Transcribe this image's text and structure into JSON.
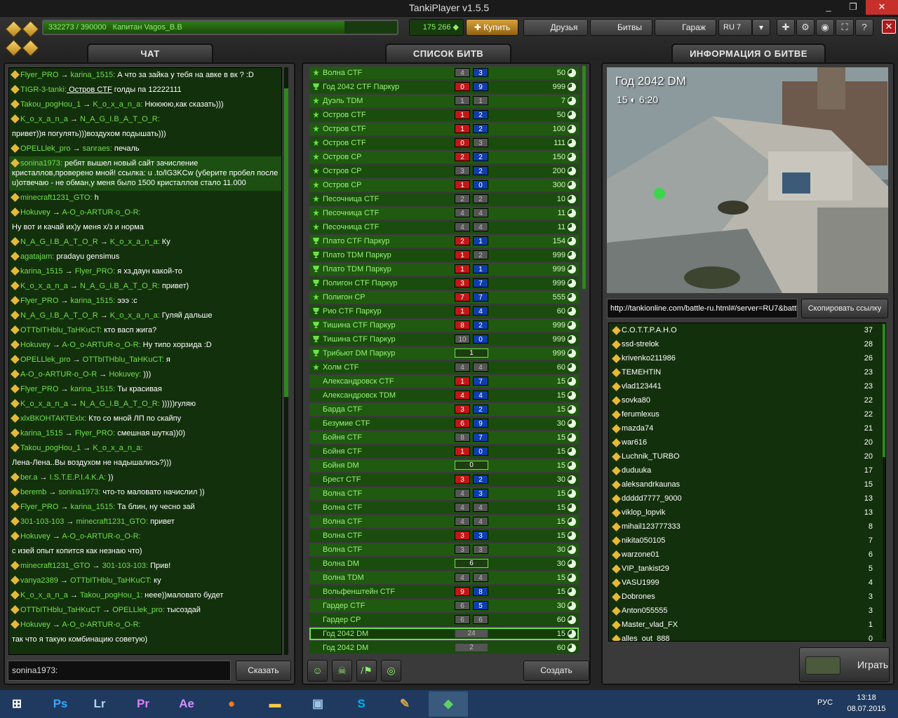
{
  "window": {
    "title": "TankiPlayer v1.5.5",
    "min": "_",
    "max": "❐",
    "close": "✕"
  },
  "top": {
    "exp": "332273 / 390000",
    "exp_fraction": 0.852,
    "player": "Капитан Vagos_B.B",
    "crystals": "175 266",
    "buy": "Купить",
    "friends": "Друзья",
    "battles": "Битвы",
    "garage": "Гараж",
    "lang": "RU 7",
    "close": "✕"
  },
  "tabs": {
    "chat": "ЧАТ",
    "battles": "СПИСОК БИТВ",
    "info": "ИНФОРМАЦИЯ О БИТВЕ"
  },
  "chat": [
    {
      "p": [
        [
          "s",
          "Flyer_PRO"
        ],
        [
          "a",
          " → "
        ],
        [
          "r",
          "karina_1515:"
        ],
        [
          "t",
          " А что за зайка у тебя на авке в вк ? :D"
        ]
      ]
    },
    {
      "p": [
        [
          "s",
          "TIGR-3-tanki:"
        ],
        [
          "u",
          " Остров CTF"
        ],
        [
          "t",
          " голды па 12222111"
        ]
      ]
    },
    {
      "p": [
        [
          "s",
          "Takou_pogHou_1"
        ],
        [
          "a",
          " → "
        ],
        [
          "r",
          "K_o_x_a_n_a:"
        ],
        [
          "t",
          " Нюююю,как сказать)))"
        ]
      ]
    },
    {
      "p": [
        [
          "s",
          "K_o_x_a_n_a"
        ],
        [
          "a",
          " → "
        ],
        [
          "r",
          "N_A_G_I.B_A_T_O_R:"
        ]
      ]
    },
    {
      "p": [
        [
          "t",
          "привет))я погулять)))воздухом подышать)))"
        ]
      ],
      "np": 1
    },
    {
      "p": [
        [
          "s",
          "OPELLlek_pro"
        ],
        [
          "a",
          " → "
        ],
        [
          "r",
          "sanraes:"
        ],
        [
          "t",
          " печаль"
        ]
      ]
    },
    {
      "p": [
        [
          "s",
          "sonina1973:"
        ],
        [
          "t",
          " ребят вышел новый сайт зачисление кристаллов,проверено мной! ссылка: u .to/lG3KCw (уберите пробел после u)отвечаю - не обман,у меня было 1500 кристаллов стало 11.000"
        ]
      ],
      "hl": 1
    },
    {
      "p": [
        [
          "s",
          "minecraft1231_GTO:"
        ],
        [
          "t",
          " h"
        ]
      ]
    },
    {
      "p": [
        [
          "s",
          "Hokuvey"
        ],
        [
          "a",
          " → "
        ],
        [
          "r",
          "A-O_o-ARTUR-o_O-R:"
        ]
      ]
    },
    {
      "p": [
        [
          "t",
          "Ну вот и качай их)у меня х/з и норма"
        ]
      ],
      "np": 1
    },
    {
      "p": [
        [
          "s",
          "N_A_G_I.B_A_T_O_R"
        ],
        [
          "a",
          " → "
        ],
        [
          "r",
          "K_o_x_a_n_a:"
        ],
        [
          "t",
          " Ку"
        ]
      ]
    },
    {
      "p": [
        [
          "s",
          "agatajam:"
        ],
        [
          "t",
          " pradayu gensimus"
        ]
      ]
    },
    {
      "p": [
        [
          "s",
          "karina_1515"
        ],
        [
          "a",
          " → "
        ],
        [
          "r",
          "Flyer_PRO:"
        ],
        [
          "t",
          " я хз,даун какой-то"
        ]
      ]
    },
    {
      "p": [
        [
          "s",
          "K_o_x_a_n_a"
        ],
        [
          "a",
          " → "
        ],
        [
          "r",
          "N_A_G_I.B_A_T_O_R:"
        ],
        [
          "t",
          " привет)"
        ]
      ]
    },
    {
      "p": [
        [
          "s",
          "Flyer_PRO"
        ],
        [
          "a",
          " → "
        ],
        [
          "r",
          "karina_1515:"
        ],
        [
          "t",
          " эээ :c"
        ]
      ]
    },
    {
      "p": [
        [
          "s",
          "N_A_G_I.B_A_T_O_R"
        ],
        [
          "a",
          " → "
        ],
        [
          "r",
          "K_o_x_a_n_a:"
        ],
        [
          "t",
          " Гуляй дальше"
        ]
      ]
    },
    {
      "p": [
        [
          "s",
          "OTTbITHblu_TaHKuCT:"
        ],
        [
          "t",
          " кто васп жига?"
        ]
      ]
    },
    {
      "p": [
        [
          "s",
          "Hokuvey"
        ],
        [
          "a",
          " → "
        ],
        [
          "r",
          "A-O_o-ARTUR-o_O-R:"
        ],
        [
          "t",
          " Ну типо хорзида :D"
        ]
      ]
    },
    {
      "p": [
        [
          "s",
          "OPELLlek_pro"
        ],
        [
          "a",
          " → "
        ],
        [
          "r",
          "OTTbITHblu_TaHKuCT:"
        ],
        [
          "t",
          " я"
        ]
      ]
    },
    {
      "p": [
        [
          "s",
          "A-O_o-ARTUR-o_O-R"
        ],
        [
          "a",
          " → "
        ],
        [
          "r",
          "Hokuvey:"
        ],
        [
          "t",
          " )))"
        ]
      ]
    },
    {
      "p": [
        [
          "s",
          "Flyer_PRO"
        ],
        [
          "a",
          " → "
        ],
        [
          "r",
          "karina_1515:"
        ],
        [
          "t",
          " Ты красивая"
        ]
      ]
    },
    {
      "p": [
        [
          "s",
          "K_o_x_a_n_a"
        ],
        [
          "a",
          " → "
        ],
        [
          "r",
          "N_A_G_I.B_A_T_O_R:"
        ],
        [
          "t",
          " )))))гуляю"
        ]
      ]
    },
    {
      "p": [
        [
          "s",
          "xlxВКОНТАКТЕxlx:"
        ],
        [
          "t",
          " Кто со мной ЛП по скайпу"
        ]
      ]
    },
    {
      "p": [
        [
          "s",
          "karina_1515"
        ],
        [
          "a",
          " → "
        ],
        [
          "r",
          "Flyer_PRO:"
        ],
        [
          "t",
          " смешная шутка))0)"
        ]
      ]
    },
    {
      "p": [
        [
          "s",
          "Takou_pogHou_1"
        ],
        [
          "a",
          " → "
        ],
        [
          "r",
          "K_o_x_a_n_a:"
        ]
      ]
    },
    {
      "p": [
        [
          "t",
          "Лена-Лена..Вы воздухом не надышались?)))"
        ]
      ],
      "np": 1
    },
    {
      "p": [
        [
          "s",
          "ber.a"
        ],
        [
          "a",
          " → "
        ],
        [
          "r",
          "I.S.T.E.P.I.4.K.A:"
        ],
        [
          "t",
          " ))"
        ]
      ]
    },
    {
      "p": [
        [
          "s",
          "beremb"
        ],
        [
          "a",
          " → "
        ],
        [
          "r",
          "sonina1973:"
        ],
        [
          "t",
          " что-то маловато начислил ))"
        ]
      ]
    },
    {
      "p": [
        [
          "s",
          "Flyer_PRO"
        ],
        [
          "a",
          " → "
        ],
        [
          "r",
          "karina_1515:"
        ],
        [
          "t",
          " Та блин, ну чесно зай"
        ]
      ]
    },
    {
      "p": [
        [
          "s",
          "301-103-103"
        ],
        [
          "a",
          " → "
        ],
        [
          "r",
          "minecraft1231_GTO:"
        ],
        [
          "t",
          " привет"
        ]
      ]
    },
    {
      "p": [
        [
          "s",
          "Hokuvey"
        ],
        [
          "a",
          " → "
        ],
        [
          "r",
          "A-O_o-ARTUR-o_O-R:"
        ]
      ]
    },
    {
      "p": [
        [
          "t",
          "с изей опыт копится как незнаю что)"
        ]
      ],
      "np": 1
    },
    {
      "p": [
        [
          "s",
          "minecraft1231_GTO"
        ],
        [
          "a",
          " → "
        ],
        [
          "r",
          "301-103-103:"
        ],
        [
          "t",
          " Прив!"
        ]
      ]
    },
    {
      "p": [
        [
          "s",
          "vanya2389"
        ],
        [
          "a",
          " → "
        ],
        [
          "r",
          "OTTbITHblu_TaHKuCT:"
        ],
        [
          "t",
          " ку"
        ]
      ]
    },
    {
      "p": [
        [
          "s",
          "K_o_x_a_n_a"
        ],
        [
          "a",
          " → "
        ],
        [
          "r",
          "Takou_pogHou_1:"
        ],
        [
          "t",
          " неее))маловато будет"
        ]
      ]
    },
    {
      "p": [
        [
          "s",
          "OTTbITHblu_TaHKuCT"
        ],
        [
          "a",
          " → "
        ],
        [
          "r",
          "OPELLlek_pro:"
        ],
        [
          "t",
          " тысоздай"
        ]
      ]
    },
    {
      "p": [
        [
          "s",
          "Hokuvey"
        ],
        [
          "a",
          " → "
        ],
        [
          "r",
          "A-O_o-ARTUR-o_O-R:"
        ]
      ]
    },
    {
      "p": [
        [
          "t",
          "так что я такую комбинацию советую)"
        ]
      ],
      "np": 1
    }
  ],
  "chat_input": "sonina1973:",
  "say": "Сказать",
  "battles": [
    {
      "n": "Волна CTF",
      "r": "4",
      "b": "3",
      "rz": 1,
      "l": "50",
      "m": "f",
      "i": "s"
    },
    {
      "n": "Год 2042 CTF Паркур",
      "r": "0",
      "b": "9",
      "l": "999",
      "m": "c",
      "i": "c"
    },
    {
      "n": "Дуэль TDM",
      "r": "1",
      "b": "1",
      "rz": 1,
      "bz": 1,
      "l": "7",
      "m": "c",
      "i": "s"
    },
    {
      "n": "Остров CTF",
      "r": "1",
      "b": "2",
      "l": "50",
      "m": "f",
      "i": "s"
    },
    {
      "n": "Остров CTF",
      "r": "1",
      "b": "2",
      "l": "100",
      "m": "f",
      "i": "s"
    },
    {
      "n": "Остров CTF",
      "r": "0",
      "b": "3",
      "bz": 1,
      "l": "111",
      "m": "f",
      "i": "s"
    },
    {
      "n": "Остров CP",
      "r": "2",
      "b": "2",
      "l": "150",
      "m": "p",
      "i": "s"
    },
    {
      "n": "Остров CP",
      "r": "3",
      "b": "2",
      "rz": 1,
      "l": "200",
      "m": "p",
      "i": "s"
    },
    {
      "n": "Остров CP",
      "r": "1",
      "b": "0",
      "l": "300",
      "m": "p",
      "i": "s"
    },
    {
      "n": "Песочница CTF",
      "r": "2",
      "b": "2",
      "rz": 1,
      "bz": 1,
      "l": "10",
      "m": "f",
      "i": "s"
    },
    {
      "n": "Песочница CTF",
      "r": "4",
      "b": "4",
      "rz": 1,
      "bz": 1,
      "l": "11",
      "m": "f",
      "i": "s"
    },
    {
      "n": "Песочница CTF",
      "r": "4",
      "b": "4",
      "rz": 1,
      "bz": 1,
      "l": "11",
      "m": "f",
      "i": "s"
    },
    {
      "n": "Плато CTF Паркур",
      "r": "2",
      "b": "1",
      "l": "154",
      "m": "f",
      "i": "c"
    },
    {
      "n": "Плато TDM Паркур",
      "r": "1",
      "b": "2",
      "bz": 1,
      "l": "999",
      "m": "c",
      "i": "c"
    },
    {
      "n": "Плато TDM Паркур",
      "r": "1",
      "b": "1",
      "l": "999",
      "m": "c",
      "i": "c"
    },
    {
      "n": "Полигон CTF Паркур",
      "r": "3",
      "b": "7",
      "l": "999",
      "m": "c",
      "i": "c"
    },
    {
      "n": "Полигон CP",
      "r": "7",
      "b": "7",
      "l": "555",
      "m": "p",
      "i": "s"
    },
    {
      "n": "Рио CTF Паркур",
      "r": "1",
      "b": "4",
      "l": "60",
      "m": "c",
      "i": "c"
    },
    {
      "n": "Тишина CTF Паркур",
      "r": "8",
      "b": "2",
      "l": "999",
      "m": "c",
      "i": "c"
    },
    {
      "n": "Тишина CTF Паркур",
      "r": "10",
      "b": "0",
      "rz": 1,
      "l": "999",
      "m": "c",
      "i": "c"
    },
    {
      "n": "Трибьют DM Паркур",
      "dm": "1",
      "l": "999",
      "m": "k",
      "i": "c"
    },
    {
      "n": "Холм CTF",
      "r": "4",
      "b": "4",
      "rz": 1,
      "bz": 1,
      "l": "60",
      "m": "c",
      "i": "s"
    },
    {
      "n": "Александровск CTF",
      "r": "1",
      "b": "7",
      "l": "15",
      "m": "c"
    },
    {
      "n": "Александровск TDM",
      "r": "4",
      "b": "4",
      "l": "15",
      "m": "c"
    },
    {
      "n": "Барда CTF",
      "r": "3",
      "b": "2",
      "l": "15",
      "m": "c"
    },
    {
      "n": "Безумие CTF",
      "r": "6",
      "b": "9",
      "l": "30",
      "m": "c"
    },
    {
      "n": "Бойня CTF",
      "r": "8",
      "b": "7",
      "rz": 1,
      "l": "15",
      "m": "c"
    },
    {
      "n": "Бойня CTF",
      "r": "1",
      "b": "0",
      "l": "15",
      "m": "c"
    },
    {
      "n": "Бойня DM",
      "dm": "0",
      "l": "15",
      "m": "c"
    },
    {
      "n": "Брест CTF",
      "r": "3",
      "b": "2",
      "l": "30",
      "m": "c"
    },
    {
      "n": "Волна CTF",
      "r": "4",
      "b": "3",
      "rz": 1,
      "l": "15",
      "m": "c"
    },
    {
      "n": "Волна CTF",
      "r": "4",
      "b": "4",
      "rz": 1,
      "bz": 1,
      "l": "15",
      "m": "c"
    },
    {
      "n": "Волна CTF",
      "r": "4",
      "b": "4",
      "rz": 1,
      "bz": 1,
      "l": "15",
      "m": "c"
    },
    {
      "n": "Волна CTF",
      "r": "3",
      "b": "3",
      "l": "15",
      "m": "c"
    },
    {
      "n": "Волна CTF",
      "r": "3",
      "b": "3",
      "rz": 1,
      "bz": 1,
      "l": "30",
      "m": "c"
    },
    {
      "n": "Волна DM",
      "dm": "6",
      "l": "30",
      "m": "c"
    },
    {
      "n": "Волна TDM",
      "r": "4",
      "b": "4",
      "rz": 1,
      "bz": 1,
      "l": "15",
      "m": "c"
    },
    {
      "n": "Вольфенштейн CTF",
      "r": "9",
      "b": "8",
      "l": "15",
      "m": "c"
    },
    {
      "n": "Гардер CTF",
      "r": "6",
      "b": "5",
      "rz": 1,
      "l": "30",
      "m": "c"
    },
    {
      "n": "Гардер CP",
      "r": "6",
      "b": "6",
      "rz": 1,
      "bz": 1,
      "l": "60",
      "m": "c"
    },
    {
      "n": "Год 2042 DM",
      "dm": "24",
      "dz": 1,
      "l": "15",
      "m": "c",
      "sel": 1
    },
    {
      "n": "Год 2042 DM",
      "dm": "2",
      "dz": 1,
      "l": "60",
      "m": "c"
    }
  ],
  "create": "Создать",
  "mode_buttons": [
    "☺",
    "☠",
    "/⚑",
    "◎"
  ],
  "info": {
    "map": "Год 2042 DM",
    "limit": "15",
    "time": "6:20",
    "url": "http://tankionline.com/battle-ru.html#/server=RU7&battle=",
    "copy": "Скопировать ссылку",
    "play": "Играть"
  },
  "players": [
    {
      "n": "C.O.T.T.P.A.H.O",
      "s": "37"
    },
    {
      "n": "ssd-strelok",
      "s": "28"
    },
    {
      "n": "krivenko211986",
      "s": "26"
    },
    {
      "n": "TEMEHTIN",
      "s": "23"
    },
    {
      "n": "vlad123441",
      "s": "23"
    },
    {
      "n": "sovka80",
      "s": "22"
    },
    {
      "n": "ferumlexus",
      "s": "22"
    },
    {
      "n": "mazda74",
      "s": "21"
    },
    {
      "n": "war616",
      "s": "20"
    },
    {
      "n": "Luchnik_TURBO",
      "s": "20"
    },
    {
      "n": "duduuka",
      "s": "17"
    },
    {
      "n": "aleksandrkaunas",
      "s": "15"
    },
    {
      "n": "ddddd7777_9000",
      "s": "13"
    },
    {
      "n": "viklop_lopvik",
      "s": "13"
    },
    {
      "n": "mihail123777333",
      "s": "8"
    },
    {
      "n": "nikita050105",
      "s": "7"
    },
    {
      "n": "warzone01",
      "s": "6"
    },
    {
      "n": "VIP_tankist29",
      "s": "5"
    },
    {
      "n": "VASU1999",
      "s": "4"
    },
    {
      "n": "Dobrones",
      "s": "3"
    },
    {
      "n": "Anton055555",
      "s": "3"
    },
    {
      "n": "Master_vlad_FX",
      "s": "1"
    },
    {
      "n": "alles_out_888",
      "s": "0"
    }
  ],
  "taskbar": {
    "apps": [
      "Ps",
      "Lr",
      "Pr",
      "Ae"
    ],
    "lang": "РУС",
    "time": "13:18",
    "date": "08.07.2015"
  }
}
